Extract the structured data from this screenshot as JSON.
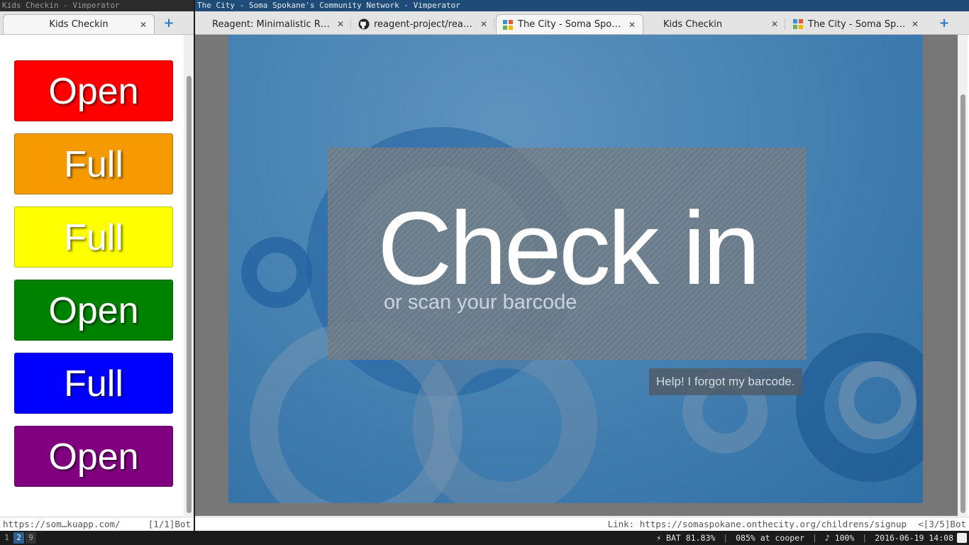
{
  "left_window": {
    "title": "Kids Checkin - Vimperator",
    "tab_label": "Kids Checkin",
    "close_glyph": "✕",
    "newtab_glyph": "+",
    "status_text": "https://som…kuapp.com/",
    "status_pos": "[1/1]Bot",
    "rooms": [
      {
        "label": "Open",
        "color": "#ff0000"
      },
      {
        "label": "Full",
        "color": "#f59a00"
      },
      {
        "label": "Full",
        "color": "#ffff00"
      },
      {
        "label": "Open",
        "color": "#008200"
      },
      {
        "label": "Full",
        "color": "#0000ff"
      },
      {
        "label": "Open",
        "color": "#800080"
      }
    ]
  },
  "right_window": {
    "title": "The City - Soma Spokane's Community Network - Vimperator",
    "tabs": [
      {
        "label": "Reagent: Minimalistic R…",
        "icon": "none"
      },
      {
        "label": "reagent-project/reag…",
        "icon": "github-icon"
      },
      {
        "label": "The City - Soma Spo…",
        "icon": "thecity-icon"
      },
      {
        "label": "Kids Checkin",
        "icon": "none"
      },
      {
        "label": "The City - Soma Spo…",
        "icon": "thecity-icon"
      }
    ],
    "active_tab": 2,
    "close_glyph": "✕",
    "newtab_glyph": "+",
    "page": {
      "heading": "Check in",
      "subheading": "or scan your barcode",
      "help_button": "Help! I forgot my barcode."
    },
    "status_text": "Link: https://somaspokane.onthecity.org/childrens/signup",
    "status_pos": "<[3/5]Bot"
  },
  "taskbar": {
    "workspaces": [
      "1",
      "2",
      "9"
    ],
    "active_workspace": "2",
    "battery": "⚡ BAT 81.83%",
    "host": "085% at cooper",
    "volume": "♪ 100%",
    "datetime": "2016-06-19 14:08",
    "sep": "|"
  }
}
